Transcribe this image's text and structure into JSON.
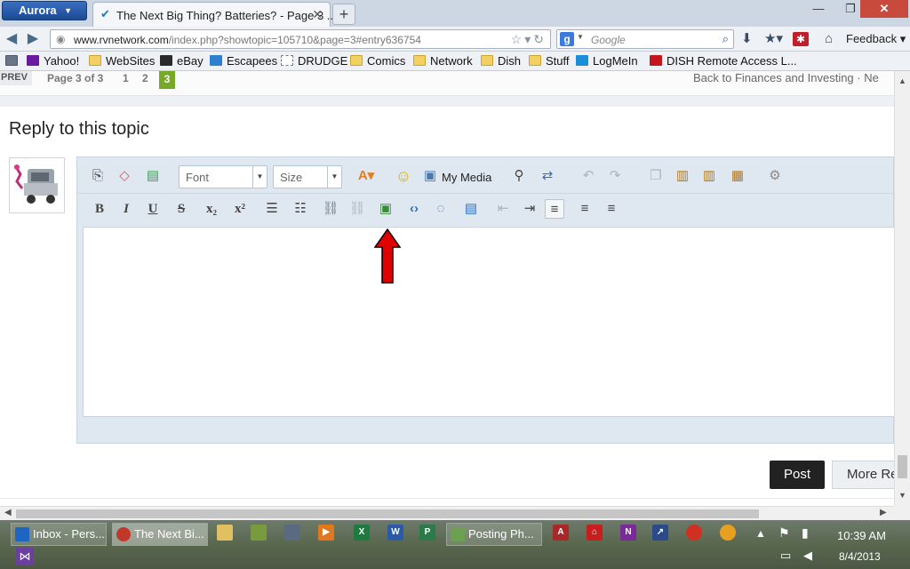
{
  "browser": {
    "app_button": "Aurora",
    "tab_title": "The Next Big Thing? Batteries? - Page 3 ...",
    "url_domain": "www.rvnetwork.com",
    "url_path": "/index.php?showtopic=105710&page=3#entry636754",
    "search_placeholder": "Google",
    "feedback_label": "Feedback",
    "bookmarks": [
      "Yahoo!",
      "WebSites",
      "eBay",
      "Escapees",
      "DRUDGE",
      "Comics",
      "Network",
      "Dish",
      "Stuff",
      "LogMeIn",
      "DISH Remote Access L..."
    ]
  },
  "pager": {
    "prev": "PREV",
    "label": "Page 3 of 3",
    "pages": [
      "1",
      "2",
      "3"
    ],
    "back_link": "Back to Finances and Investing · Ne"
  },
  "reply": {
    "title": "Reply to this topic",
    "font_label": "Font",
    "size_label": "Size",
    "my_media": "My Media",
    "post_button": "Post",
    "more_button": "More Re"
  },
  "icons": {
    "accent_red": "#e00000",
    "active_page_green": "#76a82a"
  },
  "taskbar": {
    "tasks": [
      "Inbox - Pers...",
      "The Next Bi...",
      "Posting Ph..."
    ],
    "time": "10:39 AM",
    "date": "8/4/2013"
  }
}
